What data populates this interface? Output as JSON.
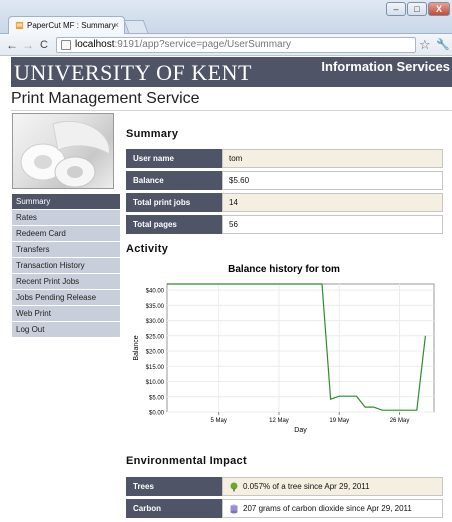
{
  "browser": {
    "tab_title": "PaperCut MF : Summary",
    "tab_close": "×",
    "url_host": "localhost",
    "url_path": ":9191/app?service=page/UserSummary",
    "window_min": "–",
    "window_max": "□",
    "window_close": "X"
  },
  "header": {
    "logo": "UNIVERSITY OF KENT",
    "service_name": "Information Services"
  },
  "page_title": "Print Management Service",
  "sidebar": {
    "items": [
      {
        "label": "Summary",
        "active": true
      },
      {
        "label": "Rates"
      },
      {
        "label": "Redeem Card"
      },
      {
        "label": "Transfers"
      },
      {
        "label": "Transaction History"
      },
      {
        "label": "Recent Print Jobs"
      },
      {
        "label": "Jobs Pending Release"
      },
      {
        "label": "Web Print"
      },
      {
        "label": "Log Out"
      }
    ]
  },
  "summary": {
    "heading": "Summary",
    "rows": [
      {
        "label": "User name",
        "value": "tom"
      },
      {
        "label": "Balance",
        "value": "$5.60"
      },
      {
        "label": "Total print jobs",
        "value": "14"
      },
      {
        "label": "Total pages",
        "value": "56"
      }
    ]
  },
  "activity": {
    "heading": "Activity"
  },
  "chart_data": {
    "type": "line",
    "title": "Balance history for tom",
    "xlabel": "Day",
    "ylabel": "Balance",
    "x_ticks": [
      "5 May",
      "12 May",
      "19 May",
      "26 May"
    ],
    "y_ticks": [
      "$0.00",
      "$5.00",
      "$10.00",
      "$15.00",
      "$20.00",
      "$25.00",
      "$30.00",
      "$35.00",
      "$40.00"
    ],
    "ylim": [
      0,
      42
    ],
    "grid": true,
    "line_color": "#2e8b2e",
    "series": [
      {
        "x": [
          "2011-04-29",
          "2011-05-17",
          "2011-05-18",
          "2011-05-19",
          "2011-05-21",
          "2011-05-22",
          "2011-05-23",
          "2011-05-24",
          "2011-05-28",
          "2011-05-29"
        ],
        "values": [
          42.0,
          42.0,
          4.2,
          5.2,
          5.2,
          1.6,
          1.6,
          0.6,
          0.6,
          25.0
        ]
      }
    ]
  },
  "environment": {
    "heading": "Environmental Impact",
    "rows": [
      {
        "label": "Trees",
        "icon": "tree-icon",
        "value": "0.057% of a tree since Apr 29, 2011"
      },
      {
        "label": "Carbon",
        "icon": "carbon-icon",
        "value": "207 grams of carbon dioxide since Apr 29, 2011"
      }
    ]
  }
}
